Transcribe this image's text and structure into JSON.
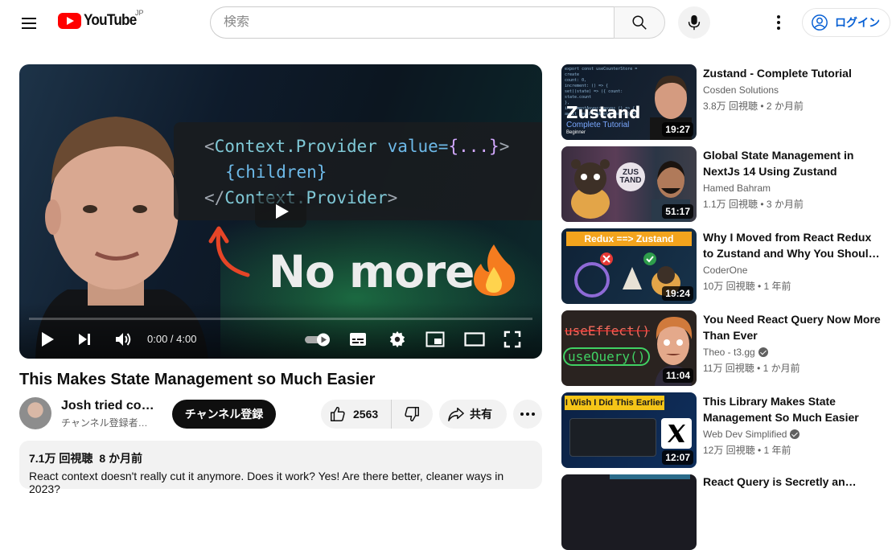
{
  "header": {
    "logo_text": "YouTube",
    "region": "JP",
    "search_placeholder": "検索",
    "login_label": "ログイン"
  },
  "player": {
    "code_line1_open": "<",
    "code_line1_tag": "Context.Provider",
    "code_line1_attr": " value=",
    "code_line1_val": "{...}",
    "code_line1_close": ">",
    "code_line2": "{children}",
    "code_line3_open": "</",
    "code_line3_tag": "Context.Provider",
    "code_line3_close": ">",
    "overlay_text": "No more",
    "time": "0:00 / 4:00",
    "progress": 0
  },
  "video": {
    "title": "This Makes State Management so Much Easier",
    "channel": "Josh tried co…",
    "subscribers": "チャンネル登録者…",
    "subscribe_label": "チャンネル登録",
    "likes": "2563",
    "share_label": "共有",
    "views": "7.1万 回視聴",
    "date": "8 か月前",
    "description": "React context doesn't really cut it anymore. Does it work? Yes! Are there better, cleaner ways in 2023?"
  },
  "related": [
    {
      "title": "Zustand - Complete Tutorial",
      "channel": "Cosden Solutions",
      "meta": "3.8万 回視聴 • 2 か月前",
      "duration": "19:27",
      "thumb_text": "Zustand",
      "thumb_sub": "Complete Tutorial",
      "thumb_tag": "Beginner"
    },
    {
      "title": "Global State Management in NextJs 14 Using Zustand",
      "channel": "Hamed Bahram",
      "meta": "1.1万 回視聴 • 3 か月前",
      "duration": "51:17",
      "thumb_text": "ZUS TAND"
    },
    {
      "title": "Why I Moved from React Redux to Zustand and Why You Shoul…",
      "channel": "CoderOne",
      "meta": "10万 回視聴 • 1 年前",
      "duration": "19:24",
      "thumb_text": "Redux ==> Zustand"
    },
    {
      "title": "You Need React Query Now More Than Ever",
      "channel": "Theo - t3.gg",
      "meta": "11万 回視聴 • 1 か月前",
      "duration": "11:04",
      "thumb_line1": "useEffect()",
      "thumb_line2": "useQuery()"
    },
    {
      "title": "This Library Makes State Management So Much Easier",
      "channel": "Web Dev Simplified",
      "meta": "12万 回視聴 • 1 年前",
      "duration": "12:07",
      "thumb_text": "I Wish I Did This Earlier"
    },
    {
      "title": "React Query is Secretly an…"
    }
  ],
  "colors": {
    "brand_red": "#ff0000",
    "link_blue": "#065fd4",
    "text_primary": "#0f0f0f",
    "text_secondary": "#606060"
  }
}
